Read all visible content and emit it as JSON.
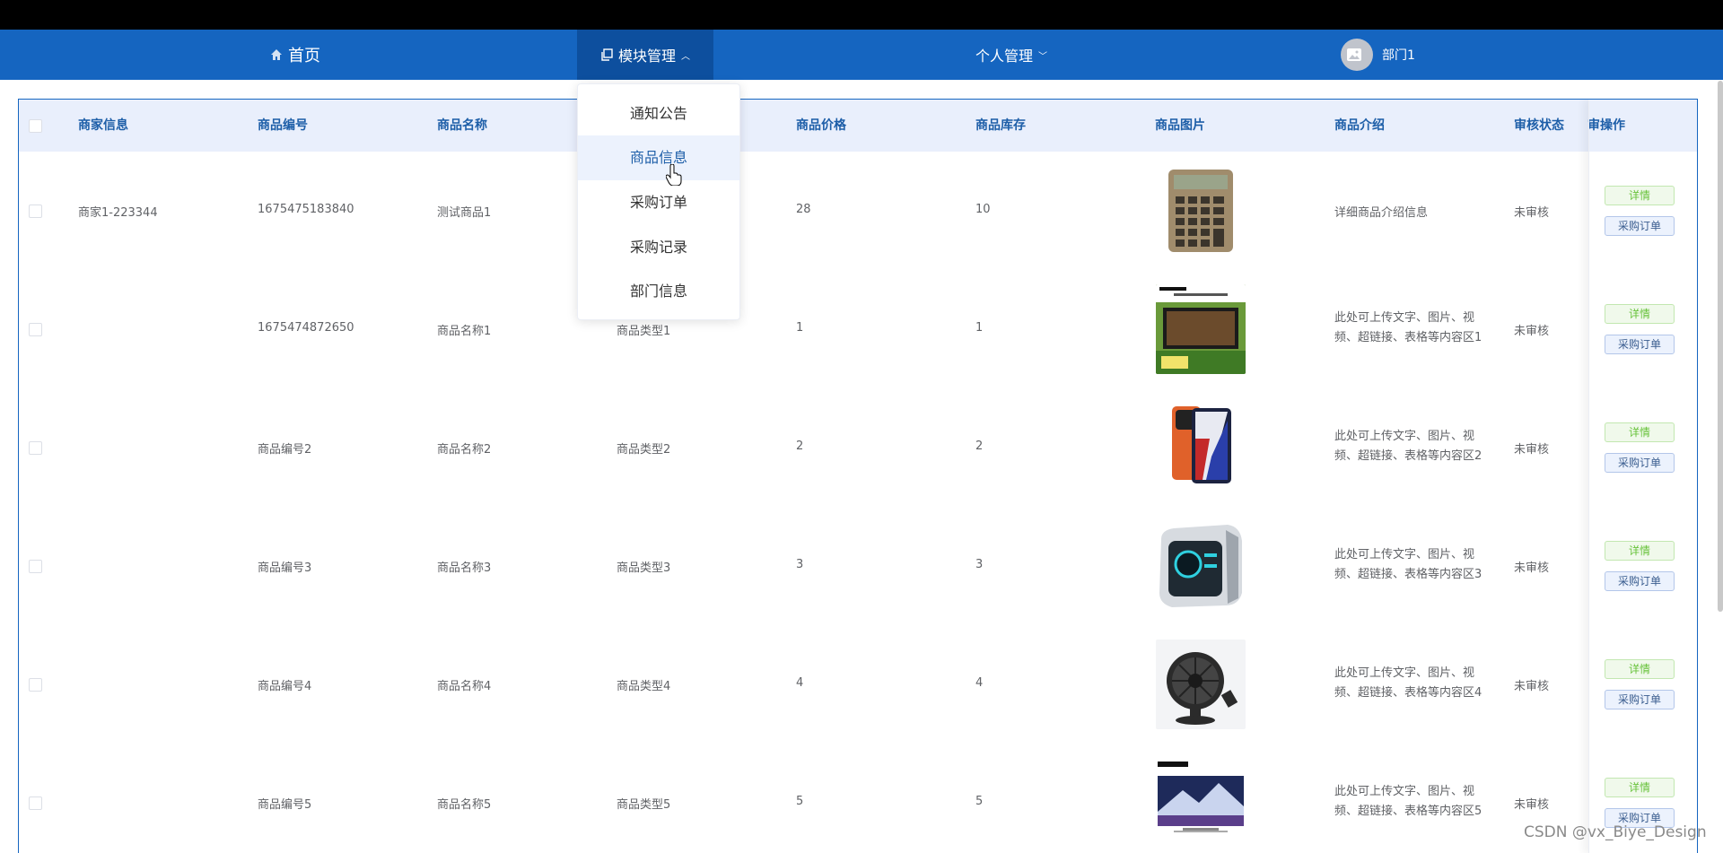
{
  "nav": {
    "home_label": "首页",
    "module_label": "模块管理",
    "personal_label": "个人管理",
    "user_label": "部门1"
  },
  "dropdown": {
    "items": [
      "通知公告",
      "商品信息",
      "采购订单",
      "采购记录",
      "部门信息"
    ],
    "active": "商品信息"
  },
  "table": {
    "headers": {
      "merchant": "商家信息",
      "code": "商品编号",
      "name": "商品名称",
      "price": "商品价格",
      "stock": "商品库存",
      "image": "商品图片",
      "intro": "商品介绍",
      "status": "审核状态",
      "extra": "审",
      "ops": "操作"
    },
    "rows": [
      {
        "merchant": "商家1-223344",
        "code": "1675475183840",
        "name": "测试商品1",
        "type": "",
        "price": "28",
        "stock": "10",
        "image": "calculator-image",
        "intro": "详细商品介绍信息",
        "status": "未审核"
      },
      {
        "merchant": "",
        "code": "1675474872650",
        "name": "商品名称1",
        "type": "商品类型1",
        "price": "1",
        "stock": "1",
        "image": "tv-ad-image",
        "intro": "此处可上传文字、图片、视频、超链接、表格等内容区1",
        "status": "未审核"
      },
      {
        "merchant": "",
        "code": "商品编号2",
        "name": "商品名称2",
        "type": "商品类型2",
        "price": "2",
        "stock": "2",
        "image": "phone-image",
        "intro": "此处可上传文字、图片、视频、超链接、表格等内容区2",
        "status": "未审核"
      },
      {
        "merchant": "",
        "code": "商品编号3",
        "name": "商品名称3",
        "type": "商品类型3",
        "price": "3",
        "stock": "3",
        "image": "computer-case-image",
        "intro": "此处可上传文字、图片、视频、超链接、表格等内容区3",
        "status": "未审核"
      },
      {
        "merchant": "",
        "code": "商品编号4",
        "name": "商品名称4",
        "type": "商品类型4",
        "price": "4",
        "stock": "4",
        "image": "fan-image",
        "intro": "此处可上传文字、图片、视频、超链接、表格等内容区4",
        "status": "未审核"
      },
      {
        "merchant": "",
        "code": "商品编号5",
        "name": "商品名称5",
        "type": "商品类型5",
        "price": "5",
        "stock": "5",
        "image": "sony-tv-image",
        "intro": "此处可上传文字、图片、视频、超链接、表格等内容区5",
        "status": "未审核"
      }
    ],
    "detail_label": "详情",
    "order_label": "采购订单"
  },
  "watermark": "CSDN @vx_Biye_Design",
  "colors": {
    "nav": "#1565c0",
    "nav_active": "#0d4f9e",
    "header_bg": "#e9effc"
  }
}
